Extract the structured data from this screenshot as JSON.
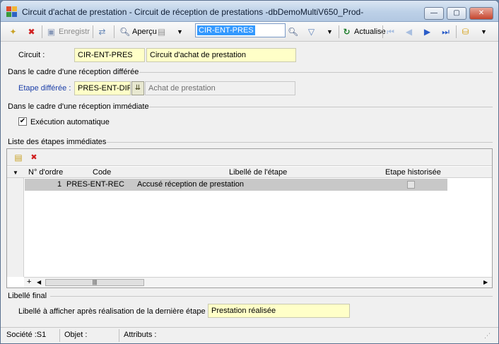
{
  "window": {
    "title": "Circuit d'achat de prestation -  Circuit de réception de prestations -dbDemoMultiV650_Prod-",
    "min_glyph": "—",
    "max_glyph": "▢",
    "close_glyph": "✕"
  },
  "toolbar": {
    "save_label": "Enregistr",
    "preview_label": "Aperçu",
    "search_value": "CIR-ENT-PRES",
    "refresh_label": "Actualise"
  },
  "form": {
    "circuit_label": "Circuit :",
    "circuit_code": "CIR-ENT-PRES",
    "circuit_name": "Circuit d'achat de prestation",
    "deferred_group": "Dans le cadre d'une réception différée",
    "deferred_step_label": "Etape différée :",
    "deferred_step_code": "PRES-ENT-DIF",
    "deferred_step_name": "Achat de prestation",
    "immediate_group": "Dans le cadre d'une réception immédiate",
    "auto_exec_label": "Exécution automatique",
    "auto_exec_checked": true,
    "steps_group": "Liste des étapes immédiates",
    "final_group": "Libellé final",
    "final_label": "Libellé à afficher après réalisation de la dernière étape :",
    "final_value": "Prestation réalisée"
  },
  "grid": {
    "columns": [
      "N° d'ordre",
      "Code",
      "Libellé de l'étape",
      "Etape historisée"
    ],
    "rows": [
      {
        "order": "1",
        "code": "PRES-ENT-REC",
        "label": "Accusé réception de prestation",
        "historised": false
      }
    ]
  },
  "status": {
    "company": "Société :S1",
    "object": "Objet :",
    "attributes": "Attributs :"
  },
  "colors": {
    "field_bg": "#ffffc8",
    "accent_blue": "#1c3fa8",
    "selection": "#3399ff"
  }
}
